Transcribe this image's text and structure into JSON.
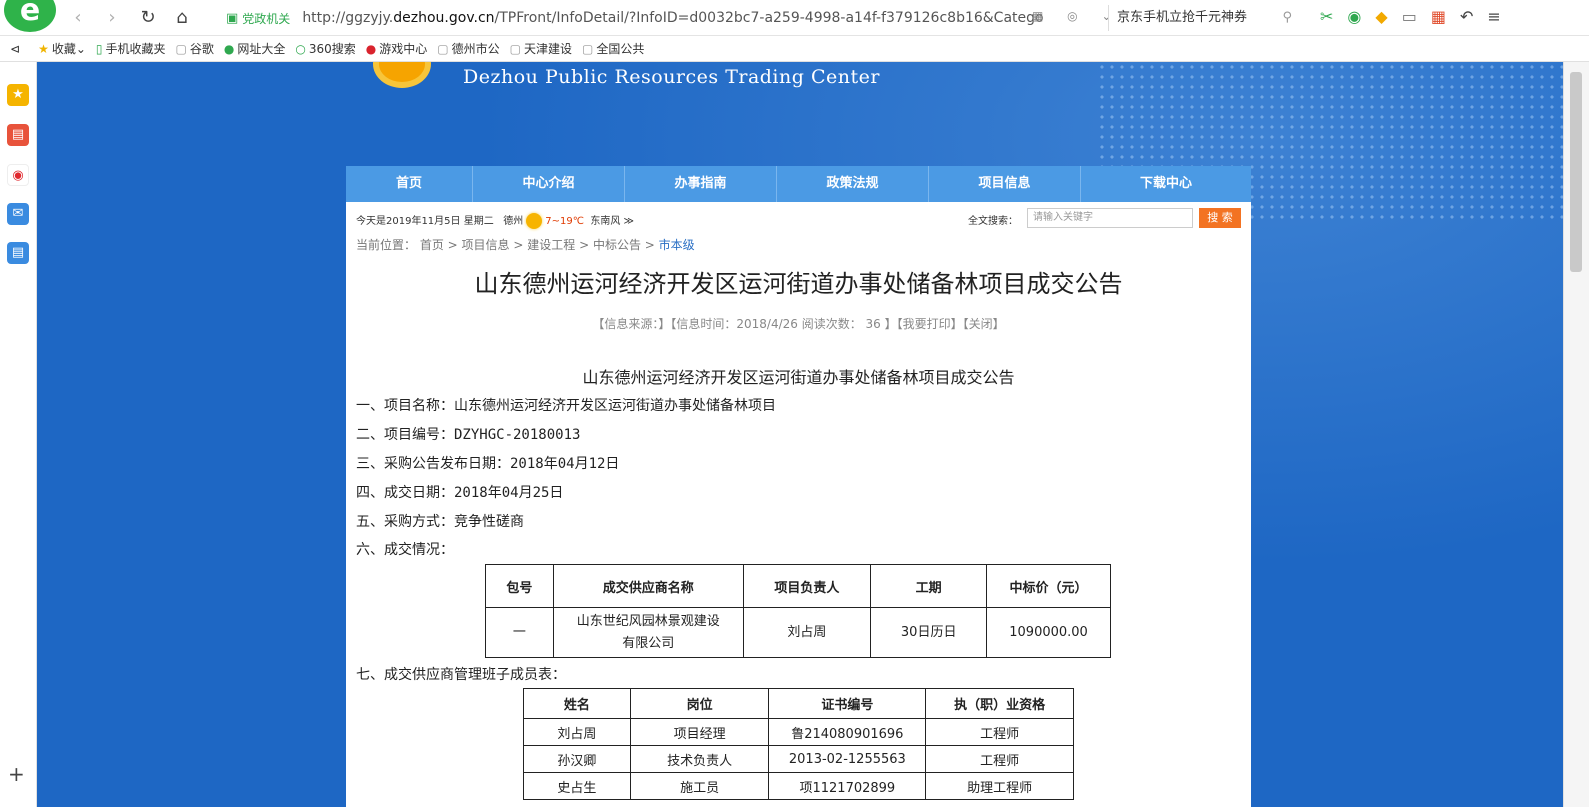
{
  "browser": {
    "address_badge": "党政机关",
    "url_prefix": "http://ggzyjy.",
    "url_domain": "dezhou.gov.cn",
    "url_suffix": "/TPFront/InfoDetail/?InfoID=d0032bc7-a259-4998-a14f-f379126c8b16&Catego",
    "search_text": "京东手机立抢千元神券"
  },
  "bookmarks": [
    {
      "label": "收藏",
      "icon": "star-icon"
    },
    {
      "label": "手机收藏夹",
      "icon": "phone-icon"
    },
    {
      "label": "谷歌",
      "icon": "page-icon"
    },
    {
      "label": "网址大全",
      "icon": "globe-icon"
    },
    {
      "label": "360搜索",
      "icon": "search-icon"
    },
    {
      "label": "游戏中心",
      "icon": "game-icon"
    },
    {
      "label": "德州市公",
      "icon": "page-icon"
    },
    {
      "label": "天津建设",
      "icon": "page-icon"
    },
    {
      "label": "全国公共",
      "icon": "page-icon"
    }
  ],
  "site": {
    "title": "Dezhou Public Resources Trading Center",
    "nav": [
      "首页",
      "中心介绍",
      "办事指南",
      "政策法规",
      "项目信息",
      "下载中心"
    ],
    "info": {
      "date": "今天是2019年11月5日 星期二",
      "city": "德州",
      "temp": "7~19℃",
      "wind": "东南风 ≫",
      "search_label": "全文搜索：",
      "search_placeholder": "请输入关键字",
      "search_button": "搜 索"
    },
    "breadcrumb": {
      "prefix": "当前位置：",
      "items": [
        "首页",
        "项目信息",
        "建设工程",
        "中标公告"
      ],
      "current": "市本级"
    }
  },
  "article": {
    "title": "山东德州运河经济开发区运河街道办事处储备林项目成交公告",
    "meta": "【信息来源：】【信息时间：2018/4/26 阅读次数： 36 】【我要打印】【关闭】",
    "subtitle": "山东德州运河经济开发区运河街道办事处储备林项目成交公告",
    "lines": [
      {
        "label": "一、项目名称：",
        "value": "山东德州运河经济开发区运河街道办事处储备林项目"
      },
      {
        "label": "二、项目编号：",
        "value": "DZYHGC-20180013"
      },
      {
        "label": "三、采购公告发布日期：",
        "value": "2018年04月12日"
      },
      {
        "label": "四、成交日期：",
        "value": "2018年04月25日"
      },
      {
        "label": "五、采购方式：",
        "value": "竞争性磋商"
      },
      {
        "label": "六、成交情况：",
        "value": ""
      }
    ],
    "deal_table": {
      "headers": [
        "包号",
        "成交供应商名称",
        "项目负责人",
        "工期",
        "中标价（元）"
      ],
      "row": [
        "一",
        "山东世纪风园林景观建设有限公司",
        "刘占周",
        "30日历日",
        "1090000.00"
      ]
    },
    "section7": "七、成交供应商管理班子成员表：",
    "team_table": {
      "headers": [
        "姓名",
        "岗位",
        "证书编号",
        "执（职）业资格"
      ],
      "rows": [
        [
          "刘占周",
          "项目经理",
          "鲁214080901696",
          "工程师"
        ],
        [
          "孙汉卿",
          "技术负责人",
          "2013-02-1255563",
          "工程师"
        ],
        [
          "史占生",
          "施工员",
          "项1121702899",
          "助理工程师"
        ]
      ]
    }
  }
}
